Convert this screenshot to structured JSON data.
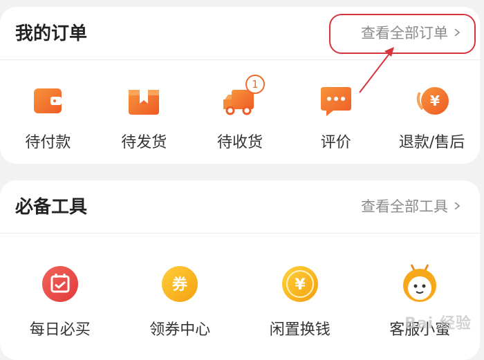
{
  "orders": {
    "title": "我的订单",
    "view_all": "查看全部订单",
    "items": [
      {
        "label": "待付款",
        "icon": "wallet-icon"
      },
      {
        "label": "待发货",
        "icon": "package-icon"
      },
      {
        "label": "待收货",
        "icon": "delivery-truck-icon",
        "badge": "1"
      },
      {
        "label": "评价",
        "icon": "comment-icon"
      },
      {
        "label": "退款/售后",
        "icon": "refund-icon"
      }
    ]
  },
  "tools": {
    "title": "必备工具",
    "view_all": "查看全部工具",
    "items": [
      {
        "label": "每日必买",
        "icon": "calendar-icon"
      },
      {
        "label": "领券中心",
        "icon": "coupon-icon",
        "glyph": "券"
      },
      {
        "label": "闲置换钱",
        "icon": "yuan-coin-icon",
        "glyph": "¥"
      },
      {
        "label": "客服小蜜",
        "icon": "bee-mascot-icon"
      }
    ]
  },
  "watermark": "Bai 经验",
  "colors": {
    "accent": "#f26a2b",
    "annotation": "#d8323d",
    "title": "#222222",
    "muted": "#8a8a8a"
  }
}
